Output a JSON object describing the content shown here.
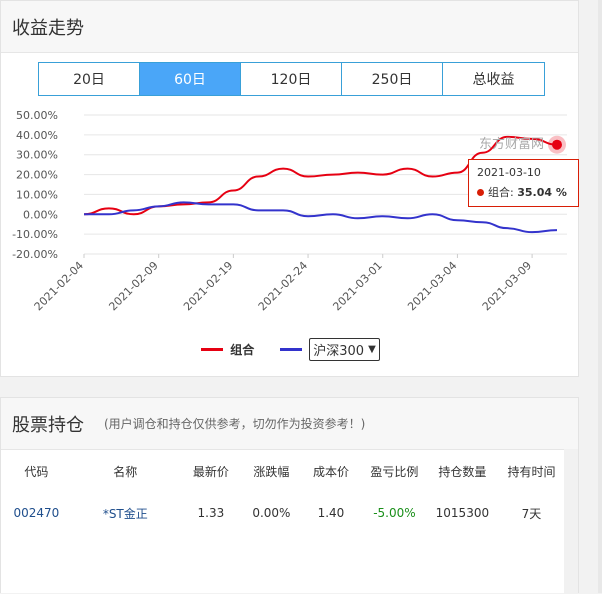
{
  "trend": {
    "title": "收益走势",
    "tabs": [
      "20日",
      "60日",
      "120日",
      "250日",
      "总收益"
    ],
    "active_tab": 1,
    "watermark": "东方财富网",
    "legend": {
      "series1": "组合",
      "series2_select": "沪深300"
    },
    "tooltip": {
      "date": "2021-03-10",
      "label": "组合",
      "value": "35.04 %"
    }
  },
  "chart_data": {
    "type": "line",
    "yticks": [
      "50.00%",
      "40.00%",
      "30.00%",
      "20.00%",
      "10.00%",
      "0.00%",
      "-10.00%",
      "-20.00%"
    ],
    "ylim": [
      -20,
      50
    ],
    "xticks": [
      "2021-02-04",
      "2021-02-09",
      "2021-02-19",
      "2021-02-24",
      "2021-03-01",
      "2021-03-04",
      "2021-03-09"
    ],
    "x": [
      "02-04",
      "02-05",
      "02-08",
      "02-09",
      "02-10",
      "02-18",
      "02-19",
      "02-22",
      "02-23",
      "02-24",
      "02-25",
      "02-26",
      "03-01",
      "03-02",
      "03-03",
      "03-04",
      "03-05",
      "03-08",
      "03-09",
      "03-10"
    ],
    "series": [
      {
        "name": "组合",
        "color": "#e60012",
        "values": [
          0,
          3,
          0,
          4,
          5,
          6,
          12,
          19,
          23,
          19,
          20,
          21,
          20,
          23,
          19,
          21,
          31,
          39,
          38,
          35.04
        ]
      },
      {
        "name": "沪深300",
        "color": "#3333cc",
        "values": [
          0,
          0,
          2,
          4,
          6,
          5,
          5,
          2,
          2,
          -1,
          0,
          -2,
          -1,
          -2,
          0,
          -3,
          -4,
          -7,
          -9,
          -8
        ]
      }
    ]
  },
  "holdings": {
    "title": "股票持仓",
    "hint": "(用户调仓和持仓仅供参考，切勿作为投资参考！)",
    "columns": [
      "代码",
      "名称",
      "最新价",
      "涨跌幅",
      "成本价",
      "盈亏比例",
      "持仓数量",
      "持有时间"
    ],
    "rows": [
      [
        "002470",
        "*ST金正",
        "1.33",
        "0.00%",
        "1.40",
        "-5.00%",
        "1015300",
        "7天"
      ]
    ]
  }
}
